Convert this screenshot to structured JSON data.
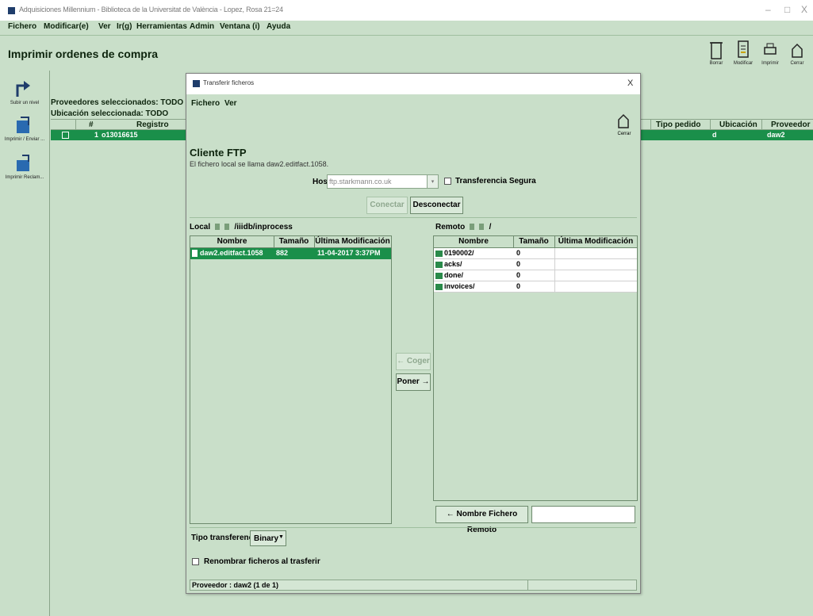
{
  "window": {
    "title": "Adquisiciones Millennium - Biblioteca de la Universitat de València - Lopez, Rosa 21=24",
    "controls": [
      "–",
      "□",
      "X"
    ]
  },
  "menubar": [
    "Fichero",
    "Modificar(e)",
    "Ver",
    "Ir(g)",
    "Herramientas",
    "Admin",
    "Ventana (i)",
    "Ayuda"
  ],
  "page_title": "Imprimir ordenes de compra",
  "toolbar": [
    {
      "label": "Borrar",
      "icon": "trash-icon"
    },
    {
      "label": "Modificar",
      "icon": "edit-icon"
    },
    {
      "label": "Imprimir",
      "icon": "print-icon"
    },
    {
      "label": "Cerrar",
      "icon": "close-door-icon"
    }
  ],
  "sidebar": [
    {
      "label": "Subir un nivel",
      "icon": "up-level-icon"
    },
    {
      "label": "Imprimir / Enviar ...",
      "icon": "print-send-icon"
    },
    {
      "label": "Imprimir Reclam...",
      "icon": "print-claim-icon"
    }
  ],
  "info": {
    "suppliers": "Proveedores seleccionados: TODO",
    "location": "Ubicación seleccionada: TODO"
  },
  "table": {
    "headers": [
      "#",
      "Registro",
      "Tipo pedido",
      "Ubicación",
      "Proveedor"
    ],
    "row": {
      "num": "1",
      "record": "o13016615",
      "location": "d",
      "supplier": "daw2"
    }
  },
  "dialog": {
    "title": "Transferir ficheros",
    "close": "X",
    "menu": [
      "Fichero",
      "Ver"
    ],
    "cerrar_label": "Cerrar",
    "heading": "Cliente FTP",
    "subtext": "El fichero local se llama daw2.editfact.1058.",
    "host_label": "Host",
    "host_value": "ftp.starkmann.co.uk",
    "secure_label": "Transferencia Segura",
    "connect_btn": "Conectar",
    "disconnect_btn": "Desconectar",
    "local_label": "Local",
    "local_path": "/iiidb/inprocess",
    "remote_label": "Remoto",
    "remote_path": "/",
    "cols": {
      "name": "Nombre",
      "size": "Tamaño",
      "modified": "Última Modificación"
    },
    "local_files": [
      {
        "name": "daw2.editfact.1058",
        "size": "882",
        "modified": "11-04-2017 3:37PM"
      }
    ],
    "remote_files": [
      {
        "name": "0190002/",
        "size": "0",
        "modified": ""
      },
      {
        "name": "acks/",
        "size": "0",
        "modified": ""
      },
      {
        "name": "done/",
        "size": "0",
        "modified": ""
      },
      {
        "name": "invoices/",
        "size": "0",
        "modified": ""
      }
    ],
    "get_btn": "← Coger",
    "put_btn": "Poner →",
    "remote_name_btn": "← Nombre Fichero Remoto",
    "transfer_type_label": "Tipo transferencia:",
    "transfer_type_value": "Binary",
    "rename_label": "Renombrar ficheros al trasferir",
    "status": "Proveedor : daw2  (1 de 1)"
  }
}
